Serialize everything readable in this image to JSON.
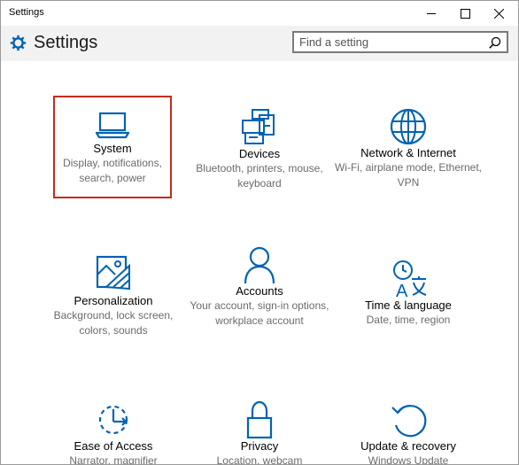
{
  "window": {
    "title": "Settings",
    "controls": [
      "minimize",
      "maximize",
      "close"
    ]
  },
  "header": {
    "title": "Settings",
    "search_placeholder": "Find a setting"
  },
  "accent_color": "#0063b1",
  "selection_color": "#c42b1c",
  "tiles": [
    {
      "label": "System",
      "desc": "Display, notifications, search, power",
      "icon": "laptop-icon",
      "selected": true
    },
    {
      "label": "Devices",
      "desc": "Bluetooth, printers, mouse, keyboard",
      "icon": "devices-icon"
    },
    {
      "label": "Network & Internet",
      "desc": "Wi-Fi, airplane mode, Ethernet, VPN",
      "icon": "globe-icon"
    },
    {
      "label": "Personalization",
      "desc": "Background, lock screen, colors, sounds",
      "icon": "personalization-icon"
    },
    {
      "label": "Accounts",
      "desc": "Your account, sign-in options, workplace account",
      "icon": "person-icon"
    },
    {
      "label": "Time & language",
      "desc": "Date, time, region",
      "icon": "time-language-icon"
    },
    {
      "label": "Ease of Access",
      "desc": "Narrator, magnifier",
      "icon": "ease-of-access-icon"
    },
    {
      "label": "Privacy",
      "desc": "Location, webcam",
      "icon": "lock-icon"
    },
    {
      "label": "Update & recovery",
      "desc": "Windows Update",
      "icon": "update-icon"
    }
  ]
}
